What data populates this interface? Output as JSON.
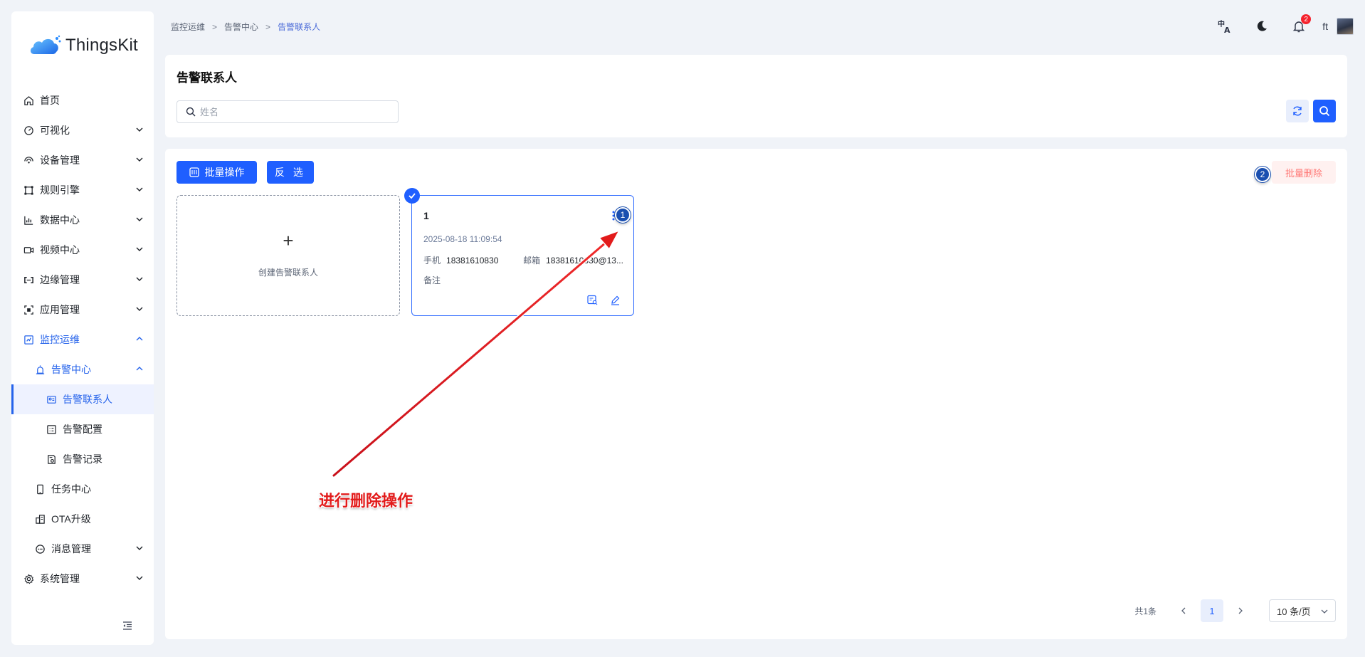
{
  "app": {
    "logo_text": "ThingsKit",
    "brand_color": "#1f5fff"
  },
  "sidebar": {
    "items": [
      {
        "label": "首页",
        "icon": "home-icon"
      },
      {
        "label": "可视化",
        "icon": "dashboard-icon"
      },
      {
        "label": "设备管理",
        "icon": "device-icon"
      },
      {
        "label": "规则引擎",
        "icon": "rule-icon"
      },
      {
        "label": "数据中心",
        "icon": "chart-icon"
      },
      {
        "label": "视频中心",
        "icon": "video-icon"
      },
      {
        "label": "边缘管理",
        "icon": "edge-icon"
      },
      {
        "label": "应用管理",
        "icon": "app-icon"
      },
      {
        "label": "监控运维",
        "icon": "monitor-icon"
      },
      {
        "label": "告警中心",
        "icon": "alarm-icon"
      },
      {
        "label": "告警联系人",
        "icon": "contact-icon"
      },
      {
        "label": "告警配置",
        "icon": "config-icon"
      },
      {
        "label": "告警记录",
        "icon": "record-icon"
      },
      {
        "label": "任务中心",
        "icon": "phone-icon"
      },
      {
        "label": "OTA升级",
        "icon": "ota-icon"
      },
      {
        "label": "消息管理",
        "icon": "message-icon"
      },
      {
        "label": "系统管理",
        "icon": "settings-icon"
      }
    ]
  },
  "breadcrumb": {
    "items": [
      "监控运维",
      "告警中心",
      "告警联系人"
    ]
  },
  "header": {
    "username": "ft",
    "notification_count": "2"
  },
  "search_panel": {
    "title": "告警联系人",
    "search_placeholder": "姓名"
  },
  "toolbar": {
    "batch_label": "批量操作",
    "invert_label": "反 选",
    "batch_delete_label": "批量删除"
  },
  "create_card": {
    "plus": "+",
    "label": "创建告警联系人"
  },
  "contact": {
    "name": "1",
    "created_at": "2025-08-18 11:09:54",
    "phone_label": "手机",
    "phone": "18381610830",
    "email_label": "邮箱",
    "email": "18381610830@13...",
    "note_label": "备注"
  },
  "pagination": {
    "total": "共1条",
    "current_page": "1",
    "page_size": "10 条/页"
  },
  "annotation": {
    "text": "进行删除操作",
    "step1": "1",
    "step2": "2",
    "color": "#e21b1b"
  }
}
